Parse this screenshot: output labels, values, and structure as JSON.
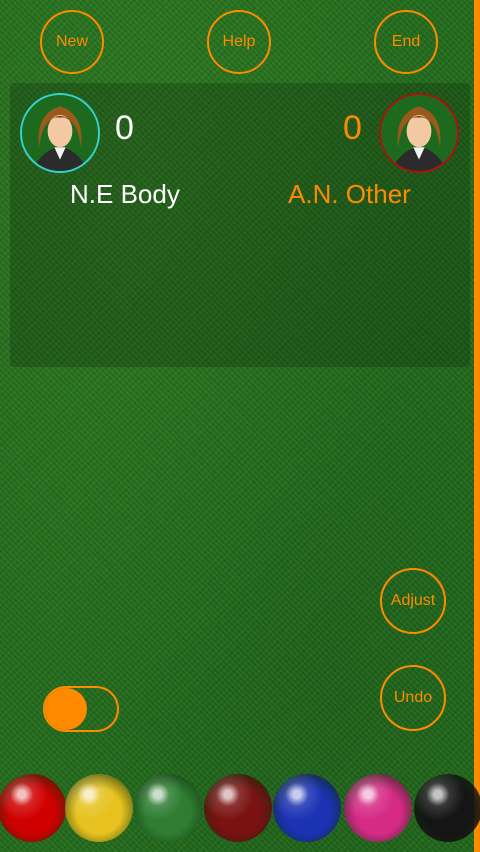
{
  "header": {
    "new_label": "New",
    "help_label": "Help",
    "end_label": "End"
  },
  "players": [
    {
      "name": "N.E Body",
      "score": "0",
      "ring_color": "#35d0d0",
      "text_color": "#ffffff"
    },
    {
      "name": "A.N. Other",
      "score": "0",
      "ring_color": "#b01010",
      "text_color": "#ff8a00"
    }
  ],
  "controls": {
    "adjust_label": "Adjust",
    "undo_label": "Undo",
    "toggle_on": true
  },
  "balls": [
    {
      "name": "red",
      "color": "#d00000"
    },
    {
      "name": "yellow",
      "color": "#e7c21f"
    },
    {
      "name": "green",
      "color": "#2e7d32"
    },
    {
      "name": "brown",
      "color": "#7a1212"
    },
    {
      "name": "blue",
      "color": "#1b32b5"
    },
    {
      "name": "pink",
      "color": "#d62a86"
    },
    {
      "name": "black",
      "color": "#151515"
    }
  ],
  "accent": "#ff8a00"
}
